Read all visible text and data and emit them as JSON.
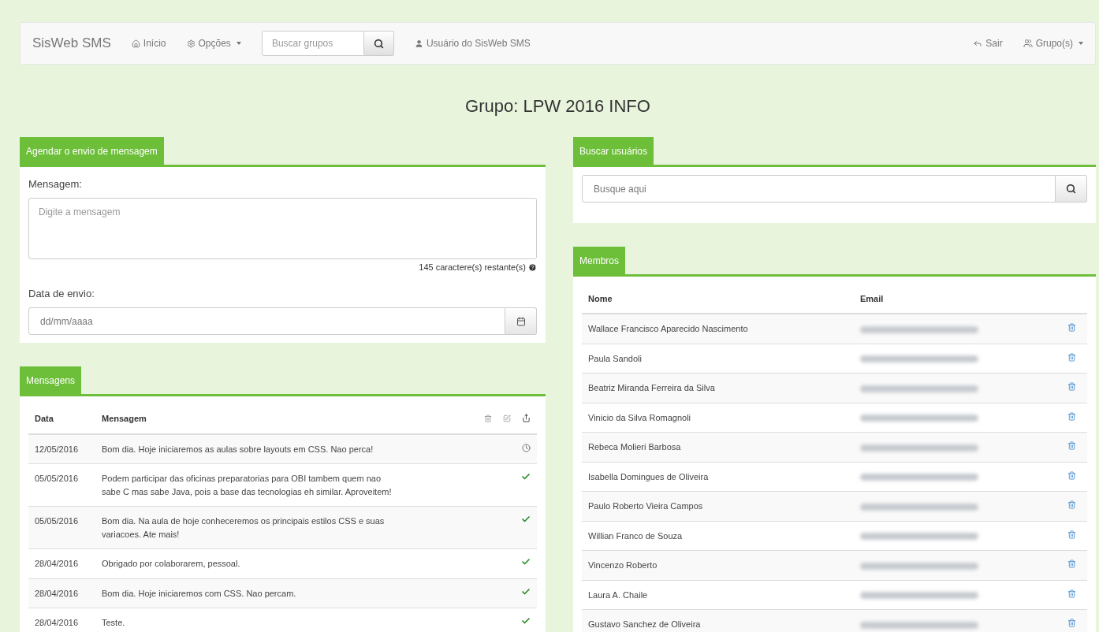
{
  "navbar": {
    "brand": "SisWeb SMS",
    "links": [
      {
        "label": "Início",
        "kind": "home",
        "dropdown": false
      },
      {
        "label": "Opções",
        "kind": "settings",
        "dropdown": true
      }
    ],
    "search": {
      "placeholder": "Buscar grupos"
    },
    "user": "Usuário do SisWeb SMS",
    "right": [
      {
        "label": "Sair",
        "kind": "logout",
        "dropdown": false
      },
      {
        "label": "Grupo(s)",
        "kind": "groups",
        "dropdown": true
      }
    ]
  },
  "page_title": "Grupo: LPW 2016 INFO",
  "schedule": {
    "tab": "Agendar o envio de mensagem",
    "message_label": "Mensagem:",
    "message_placeholder": "Digite a mensagem",
    "counter": "145 caractere(s) restante(s)",
    "date_label": "Data de envio:",
    "date_placeholder": "dd/mm/aaaa"
  },
  "messages": {
    "tab": "Mensagens",
    "columns": [
      "Data",
      "Mensagem"
    ],
    "rows": [
      {
        "date": "12/05/2016",
        "text": "Bom dia. Hoje iniciaremos as aulas sobre layouts em CSS. Nao perca!",
        "sent": false
      },
      {
        "date": "05/05/2016",
        "text": "Podem participar das oficinas preparatorias para OBI tambem quem nao sabe C mas sabe Java, pois a base das tecnologias eh similar. Aproveitem!",
        "sent": true
      },
      {
        "date": "05/05/2016",
        "text": "Bom dia. Na aula de hoje conheceremos os principais estilos CSS e suas variacoes. Ate mais!",
        "sent": true
      },
      {
        "date": "28/04/2016",
        "text": "Obrigado por colaborarem, pessoal.",
        "sent": true
      },
      {
        "date": "28/04/2016",
        "text": "Bom dia. Hoje iniciaremos com CSS. Nao percam.",
        "sent": true
      },
      {
        "date": "28/04/2016",
        "text": "Teste.",
        "sent": true
      }
    ]
  },
  "user_search": {
    "tab": "Buscar usuários",
    "placeholder": "Busque aqui"
  },
  "members": {
    "tab": "Membros",
    "columns": [
      "Nome",
      "Email"
    ],
    "rows": [
      {
        "name": "Wallace Francisco Aparecido Nascimento"
      },
      {
        "name": "Paula Sandoli"
      },
      {
        "name": "Beatriz Miranda Ferreira da Silva"
      },
      {
        "name": "Vinicio da Silva Romagnoli"
      },
      {
        "name": "Rebeca Molieri Barbosa"
      },
      {
        "name": "Isabella Domingues de Oliveira"
      },
      {
        "name": "Paulo Roberto Vieira Campos"
      },
      {
        "name": "Willian Franco de Souza"
      },
      {
        "name": "Vincenzo Roberto"
      },
      {
        "name": "Laura A. Chaile"
      },
      {
        "name": "Gustavo Sanchez de Oliveira"
      }
    ]
  }
}
